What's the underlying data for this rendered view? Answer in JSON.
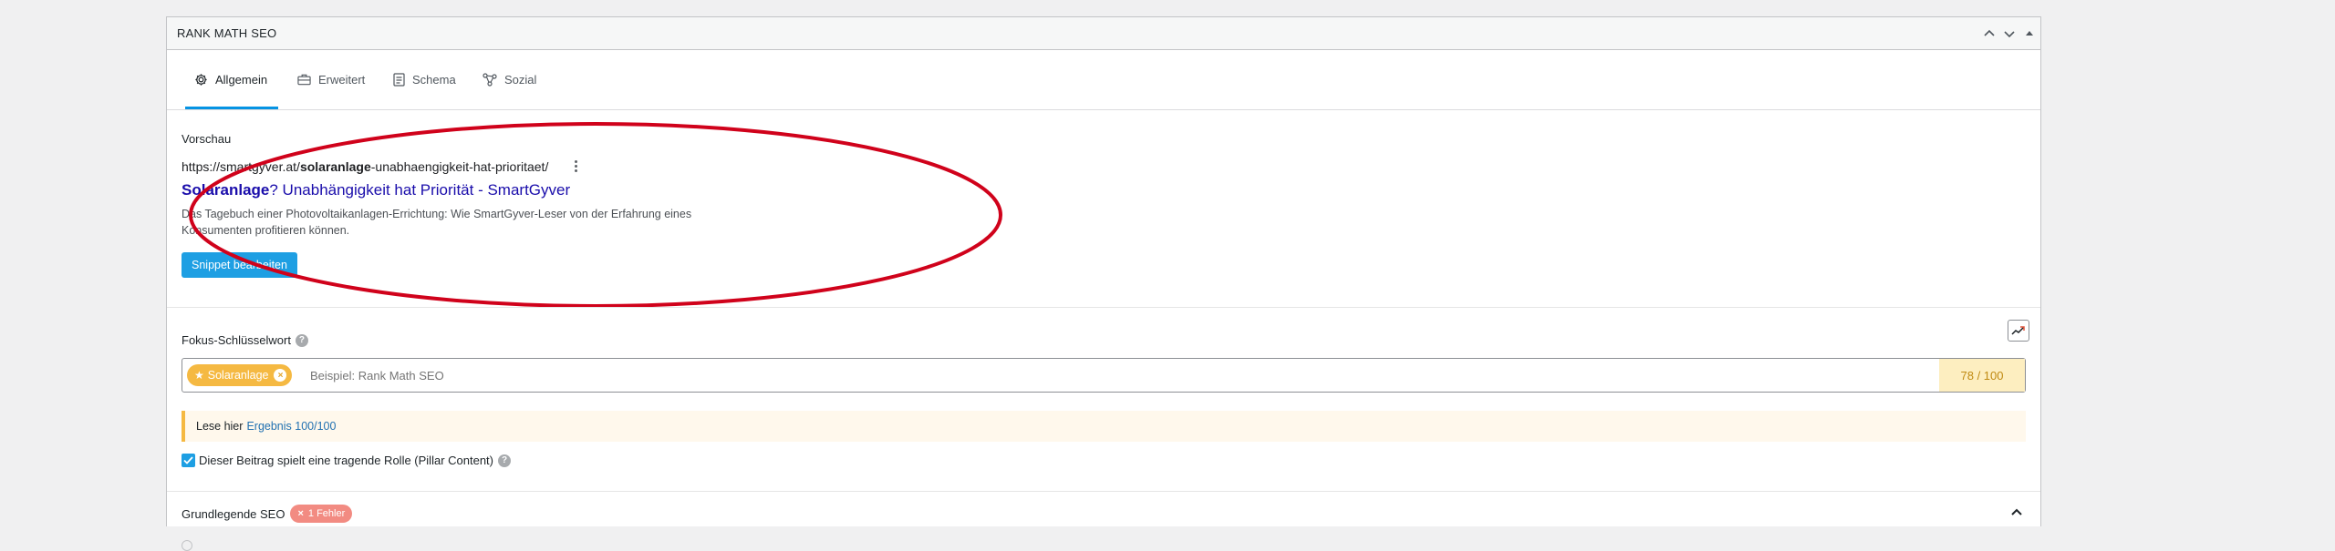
{
  "panel": {
    "title": "RANK MATH SEO"
  },
  "tabs": [
    {
      "label": "Allgemein",
      "icon": "gear-icon",
      "active": true
    },
    {
      "label": "Erweitert",
      "icon": "toolbox-icon",
      "active": false
    },
    {
      "label": "Schema",
      "icon": "schema-doc-icon",
      "active": false
    },
    {
      "label": "Sozial",
      "icon": "share-nodes-icon",
      "active": false
    }
  ],
  "preview": {
    "label": "Vorschau",
    "url_prefix": "https://smartgyver.at/",
    "url_bold": "solaranlage",
    "url_suffix": "-unabhaengigkeit-hat-prioritaet/",
    "title_bold": "Solaranlage",
    "title_rest": "? Unabhängigkeit hat Priorität - SmartGyver",
    "description_line1": "Das Tagebuch einer Photovoltaikanlagen-Errichtung: Wie SmartGyver-Leser von der Erfahrung eines",
    "description_line2": "Konsumenten profitieren können.",
    "edit_button": "Snippet bearbeiten",
    "annotation_color": "#d0021b"
  },
  "focus_keyword": {
    "label": "Fokus-Schlüsselwort",
    "tag": "Solaranlage",
    "placeholder": "Beispiel: Rank Math SEO",
    "score": "78 / 100",
    "score_color": "#f5b942"
  },
  "info": {
    "text": "Lese hier",
    "link": "Ergebnis 100/100"
  },
  "pillar": {
    "checked": true,
    "label": "Dieser Beitrag spielt eine tragende Rolle (Pillar Content)"
  },
  "basic_seo": {
    "label": "Grundlegende SEO",
    "badge": "1 Fehler"
  },
  "colors": {
    "accent": "#1e9fe3",
    "link": "#1a0dab",
    "error": "#f28b82"
  }
}
